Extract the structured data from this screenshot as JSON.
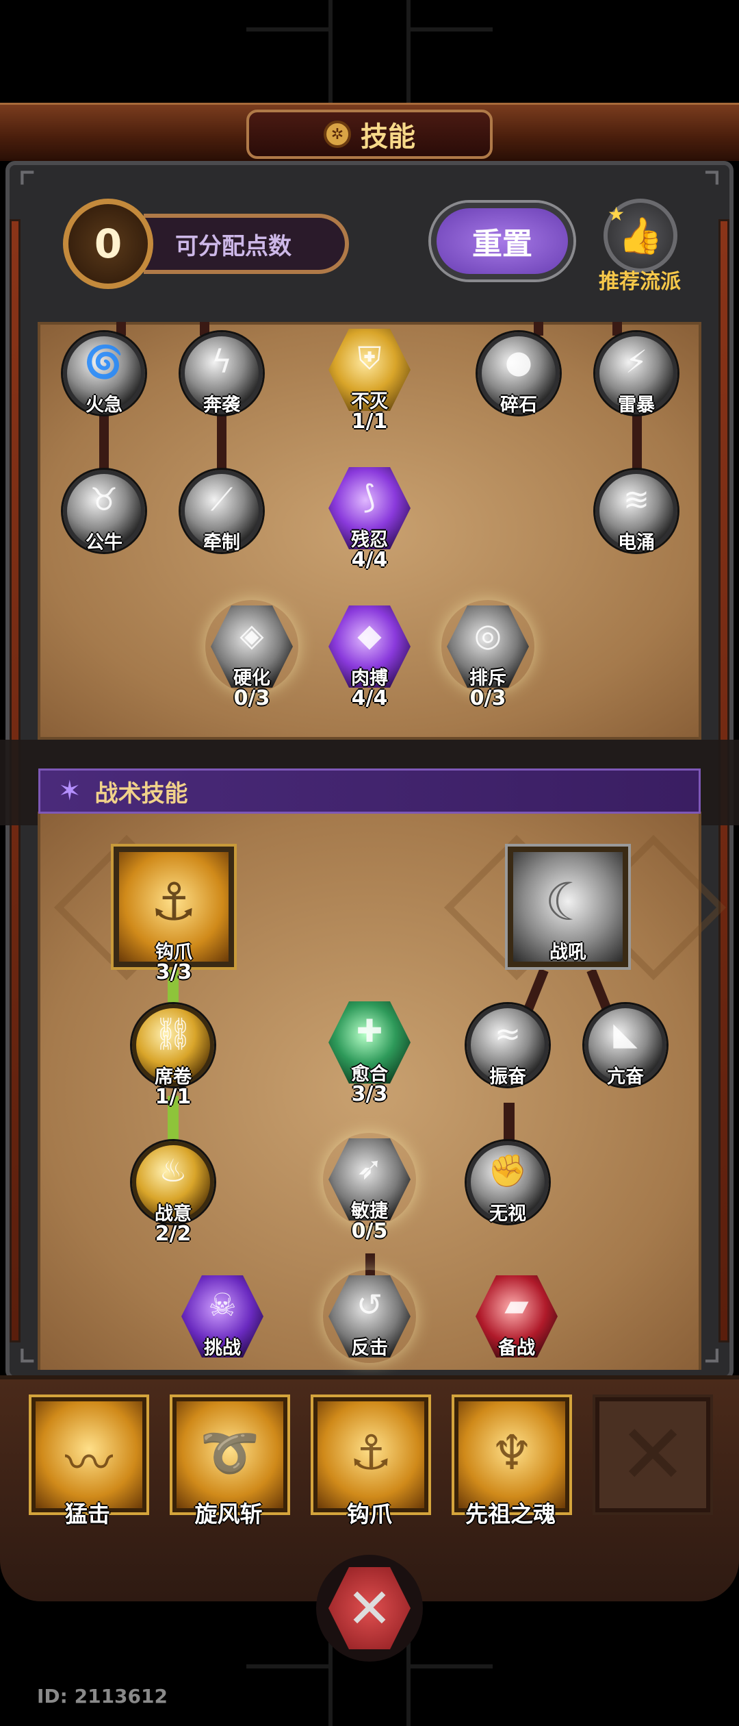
{
  "header": {
    "title": "技能",
    "title_icon": "gear-wheel-icon"
  },
  "skill_points": {
    "value": "0",
    "label": "可分配点数"
  },
  "reset_button": {
    "label": "重置"
  },
  "recommend": {
    "label": "推荐流派",
    "icon": "thumbs-up-icon"
  },
  "talent_nodes": [
    {
      "name": "火急",
      "level": "",
      "shape": "circle",
      "icon": "swirl-icon"
    },
    {
      "name": "奔袭",
      "level": "",
      "shape": "circle",
      "icon": "lightning-icon"
    },
    {
      "name": "不灭",
      "level": "1/1",
      "shape": "hex-gold",
      "icon": "armor-icon"
    },
    {
      "name": "碎石",
      "level": "",
      "shape": "circle",
      "icon": "rock-icon"
    },
    {
      "name": "雷暴",
      "level": "",
      "shape": "circle",
      "icon": "storm-icon"
    },
    {
      "name": "公牛",
      "level": "",
      "shape": "circle",
      "icon": "bull-icon"
    },
    {
      "name": "牵制",
      "level": "",
      "shape": "circle",
      "icon": "slash-icon"
    },
    {
      "name": "残忍",
      "level": "4/4",
      "shape": "hex-purple",
      "icon": "claw-icon"
    },
    {
      "name": "电涌",
      "level": "",
      "shape": "circle",
      "icon": "surge-icon"
    },
    {
      "name": "硬化",
      "level": "0/3",
      "shape": "hex-grey",
      "icon": "shield-icon"
    },
    {
      "name": "肉搏",
      "level": "4/4",
      "shape": "hex-purple",
      "icon": "crystal-icon"
    },
    {
      "name": "排斥",
      "level": "0/3",
      "shape": "hex-grey",
      "icon": "vortex-icon"
    }
  ],
  "tactics_header": {
    "title": "战术技能",
    "icon": "star-icon"
  },
  "tactic_nodes": [
    {
      "name": "钩爪",
      "level": "3/3",
      "shape": "square-gold",
      "icon": "hook-icon"
    },
    {
      "name": "战吼",
      "level": "",
      "shape": "square-grey",
      "icon": "wolf-icon"
    },
    {
      "name": "席卷",
      "level": "1/1",
      "shape": "circle-gold",
      "icon": "chain-icon"
    },
    {
      "name": "愈合",
      "level": "3/3",
      "shape": "hex-green",
      "icon": "heal-plus-icon"
    },
    {
      "name": "振奋",
      "level": "",
      "shape": "circle",
      "icon": "wind-icon"
    },
    {
      "name": "亢奋",
      "level": "",
      "shape": "circle",
      "icon": "roar-icon"
    },
    {
      "name": "战意",
      "level": "2/2",
      "shape": "circle-gold",
      "icon": "flame-icon"
    },
    {
      "name": "敏捷",
      "level": "0/5",
      "shape": "hex-grey",
      "icon": "dash-icon"
    },
    {
      "name": "无视",
      "level": "",
      "shape": "circle",
      "icon": "fist-icon"
    },
    {
      "name": "挑战",
      "level": "",
      "shape": "hex-violet",
      "icon": "skull-icon"
    },
    {
      "name": "反击",
      "level": "",
      "shape": "hex-grey",
      "icon": "counter-icon"
    },
    {
      "name": "备战",
      "level": "",
      "shape": "hex-red",
      "icon": "gauntlet-icon"
    }
  ],
  "equipped_skills": [
    {
      "name": "猛击",
      "icon": "strike-icon"
    },
    {
      "name": "旋风斩",
      "icon": "whirlwind-icon"
    },
    {
      "name": "钩爪",
      "icon": "hook-icon"
    },
    {
      "name": "先祖之魂",
      "icon": "ancestor-icon"
    },
    {
      "name": "",
      "icon": "empty-slot-icon"
    }
  ],
  "close_button": {
    "icon": "crossed-swords-close-icon"
  },
  "player_id": "ID: 2113612"
}
